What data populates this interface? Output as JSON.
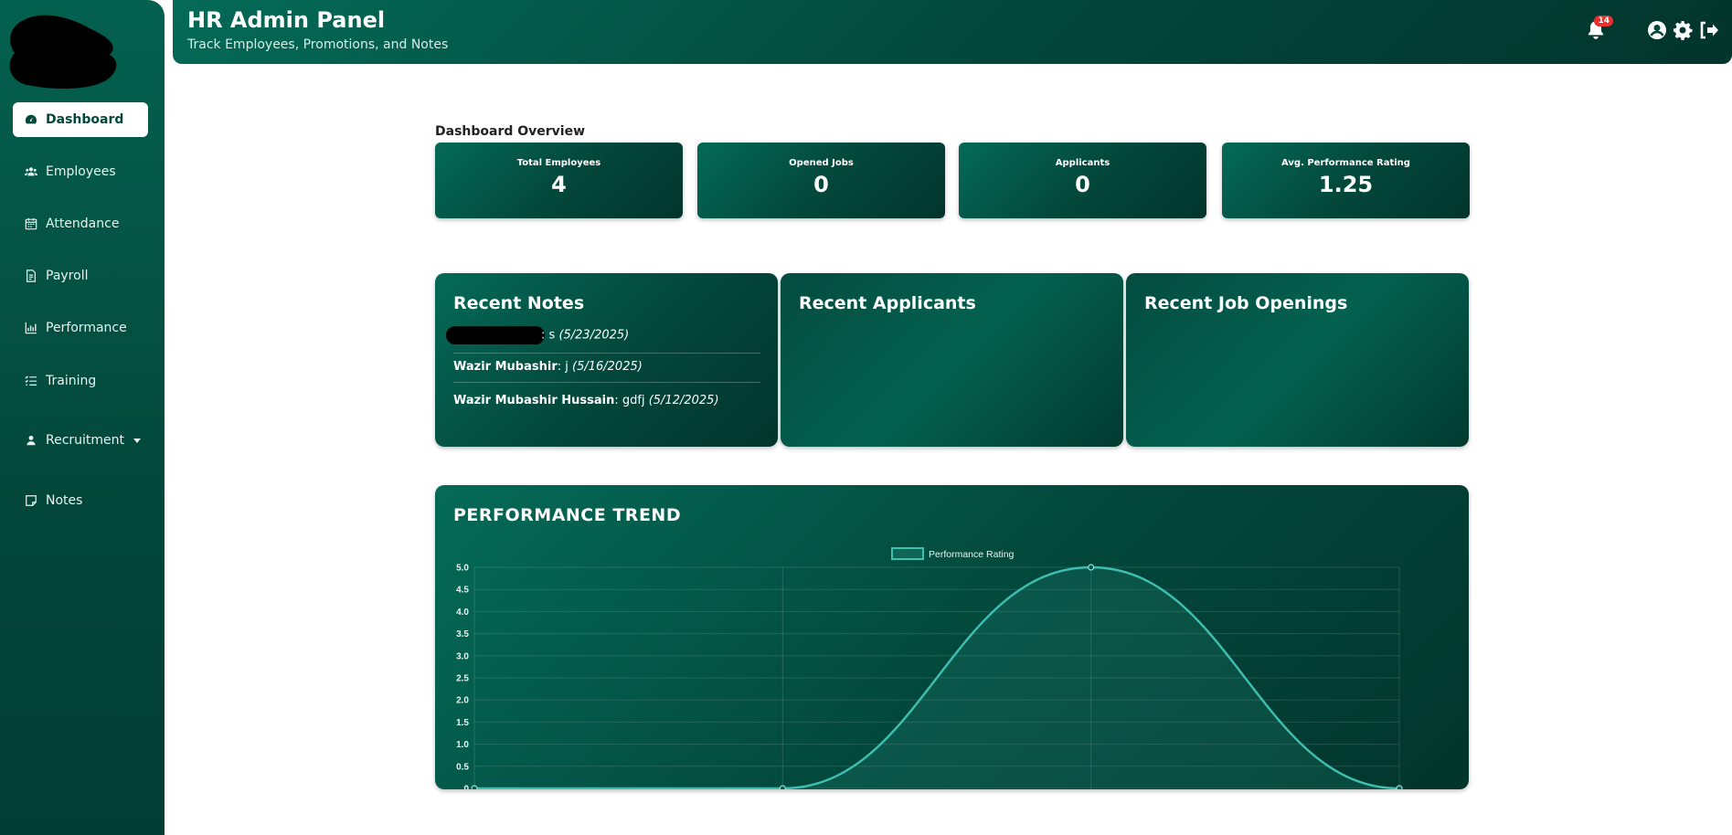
{
  "colors": {
    "accent": "#03463a",
    "chart_line": "#3fbfb0",
    "badge": "#e8312f"
  },
  "sidebar": {
    "items": [
      {
        "label": "Dashboard",
        "icon": "gauge-icon",
        "active": true
      },
      {
        "label": "Employees",
        "icon": "users-icon"
      },
      {
        "label": "Attendance",
        "icon": "calendar-icon"
      },
      {
        "label": "Payroll",
        "icon": "file-invoice-icon"
      },
      {
        "label": "Performance",
        "icon": "bar-chart-icon"
      },
      {
        "label": "Training",
        "icon": "list-check-icon"
      },
      {
        "label": "Recruitment",
        "icon": "user-tie-icon",
        "has_dropdown": true
      },
      {
        "label": "Notes",
        "icon": "sticky-note-icon"
      }
    ]
  },
  "header": {
    "title": "HR Admin Panel",
    "subtitle": "Track Employees, Promotions, and Notes",
    "notification_count": "14"
  },
  "overview": {
    "title": "Dashboard Overview",
    "stats": [
      {
        "label": "Total Employees",
        "value": "4"
      },
      {
        "label": "Opened Jobs",
        "value": "0"
      },
      {
        "label": "Applicants",
        "value": "0"
      },
      {
        "label": "Avg. Performance Rating",
        "value": "1.25"
      }
    ]
  },
  "recent_notes": {
    "title": "Recent Notes",
    "notes": [
      {
        "author": "",
        "text": ": s",
        "date": "(5/23/2025)"
      },
      {
        "author": "Wazir Mubashir",
        "text": ": j",
        "date": "(5/16/2025)"
      },
      {
        "author": "Wazir Mubashir Hussain",
        "text": ": gdfj",
        "date": "(5/12/2025)"
      }
    ]
  },
  "recent_applicants": {
    "title": "Recent Applicants"
  },
  "recent_jobs": {
    "title": "Recent Job Openings"
  },
  "chart_data": {
    "type": "line",
    "title": "PERFORMANCE TREND",
    "series": [
      {
        "name": "Performance Rating",
        "values": [
          0,
          0,
          5,
          0
        ]
      }
    ],
    "ylim": [
      0,
      5
    ],
    "yticks": [
      "0",
      "0.5",
      "1.0",
      "1.5",
      "2.0",
      "2.5",
      "3.0",
      "3.5",
      "4.0",
      "4.5",
      "5.0"
    ],
    "grid": true,
    "legend": "top-center",
    "fill": true,
    "smooth": true
  }
}
